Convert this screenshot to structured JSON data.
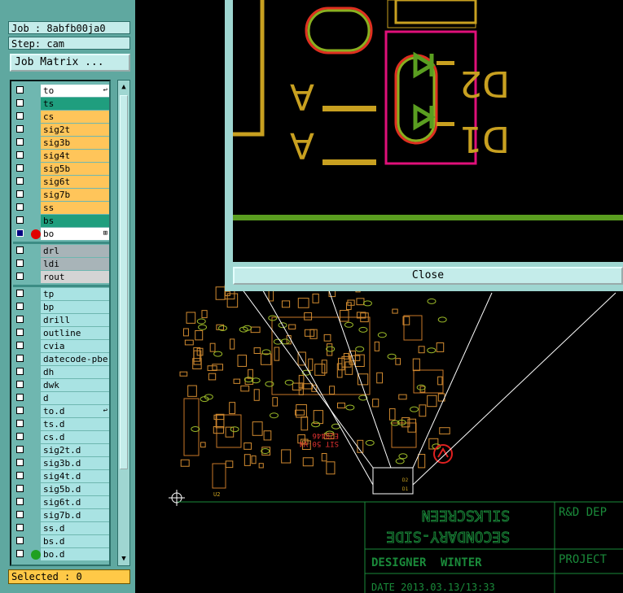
{
  "job_label": "Job : 8abfb00ja0",
  "step_label": "Step: cam",
  "matrix_button": "Job Matrix ...",
  "layers_group1": [
    {
      "name": "to",
      "color": "#ffffff",
      "checked": false,
      "tag": "↩"
    },
    {
      "name": "ts",
      "color": "#1f9e7e",
      "checked": false,
      "tag": ""
    },
    {
      "name": "cs",
      "color": "#ffc55a",
      "checked": false,
      "tag": ""
    },
    {
      "name": "sig2t",
      "color": "#ffc55a",
      "checked": false,
      "tag": ""
    },
    {
      "name": "sig3b",
      "color": "#ffc55a",
      "checked": false,
      "tag": ""
    },
    {
      "name": "sig4t",
      "color": "#ffc55a",
      "checked": false,
      "tag": ""
    },
    {
      "name": "sig5b",
      "color": "#ffc55a",
      "checked": false,
      "tag": ""
    },
    {
      "name": "sig6t",
      "color": "#ffc55a",
      "checked": false,
      "tag": ""
    },
    {
      "name": "sig7b",
      "color": "#ffc55a",
      "checked": false,
      "tag": ""
    },
    {
      "name": "ss",
      "color": "#ffc55a",
      "checked": false,
      "tag": ""
    },
    {
      "name": "bs",
      "color": "#1f9e7e",
      "checked": false,
      "tag": ""
    },
    {
      "name": "bo",
      "color": "#ffffff",
      "checked": true,
      "tag": "⊞",
      "mark": "#e00000"
    }
  ],
  "layers_group2": [
    {
      "name": "drl",
      "color": "#a8b4b8",
      "checked": false
    },
    {
      "name": "ldi",
      "color": "#a8b4b8",
      "checked": false
    },
    {
      "name": "rout",
      "color": "#d4d4d4",
      "checked": false
    }
  ],
  "layers_group3": [
    {
      "name": "tp",
      "checked": false,
      "tag": ""
    },
    {
      "name": "bp",
      "checked": false,
      "tag": ""
    },
    {
      "name": "drill",
      "checked": false,
      "tag": ""
    },
    {
      "name": "outline",
      "checked": false,
      "tag": ""
    },
    {
      "name": "cvia",
      "checked": false,
      "tag": ""
    },
    {
      "name": "datecode-pbe",
      "checked": false,
      "tag": ""
    },
    {
      "name": "dh",
      "checked": false,
      "tag": ""
    },
    {
      "name": "dwk",
      "checked": false,
      "tag": ""
    },
    {
      "name": "d",
      "checked": false,
      "tag": ""
    },
    {
      "name": "to.d",
      "checked": false,
      "tag": "↩"
    },
    {
      "name": "ts.d",
      "checked": false,
      "tag": ""
    },
    {
      "name": "cs.d",
      "checked": false,
      "tag": ""
    },
    {
      "name": "sig2t.d",
      "checked": false,
      "tag": ""
    },
    {
      "name": "sig3b.d",
      "checked": false,
      "tag": ""
    },
    {
      "name": "sig4t.d",
      "checked": false,
      "tag": ""
    },
    {
      "name": "sig5b.d",
      "checked": false,
      "tag": ""
    },
    {
      "name": "sig6t.d",
      "checked": false,
      "tag": ""
    },
    {
      "name": "sig7b.d",
      "checked": false,
      "tag": ""
    },
    {
      "name": "ss.d",
      "checked": false,
      "tag": ""
    },
    {
      "name": "bs.d",
      "checked": false,
      "tag": ""
    },
    {
      "name": "bo.d",
      "checked": false,
      "tag": "",
      "mark": "#20a020"
    }
  ],
  "group3_color": "#a9e3e3",
  "selected_label": "Selected : 0",
  "close_button": "Close",
  "zoom_labels": {
    "d2": "D2",
    "d1": "D1",
    "a": "A"
  },
  "board_labels": {
    "silk_rot": "E20446",
    "silk_rot2": "SIT 50-V4",
    "ref_u2": "U2",
    "ref_d2": "D2",
    "ref_d1": "D1"
  },
  "title_block": {
    "line1": "SILKSCREEN",
    "line2": "SECONDARY-SIDE",
    "designer": "DESIGNER",
    "designer_name": "WINTER",
    "dept": "R&D DEP",
    "project": "PROJECT",
    "date": "DATE 2013.03.13/13:33"
  },
  "colors": {
    "panel": "#5fa8a0",
    "silk": "#c8a020",
    "copper_green": "#5a9e20",
    "highlight": "#e0107a",
    "board_outline": "#c87828",
    "title_green": "#1a8a3a"
  }
}
